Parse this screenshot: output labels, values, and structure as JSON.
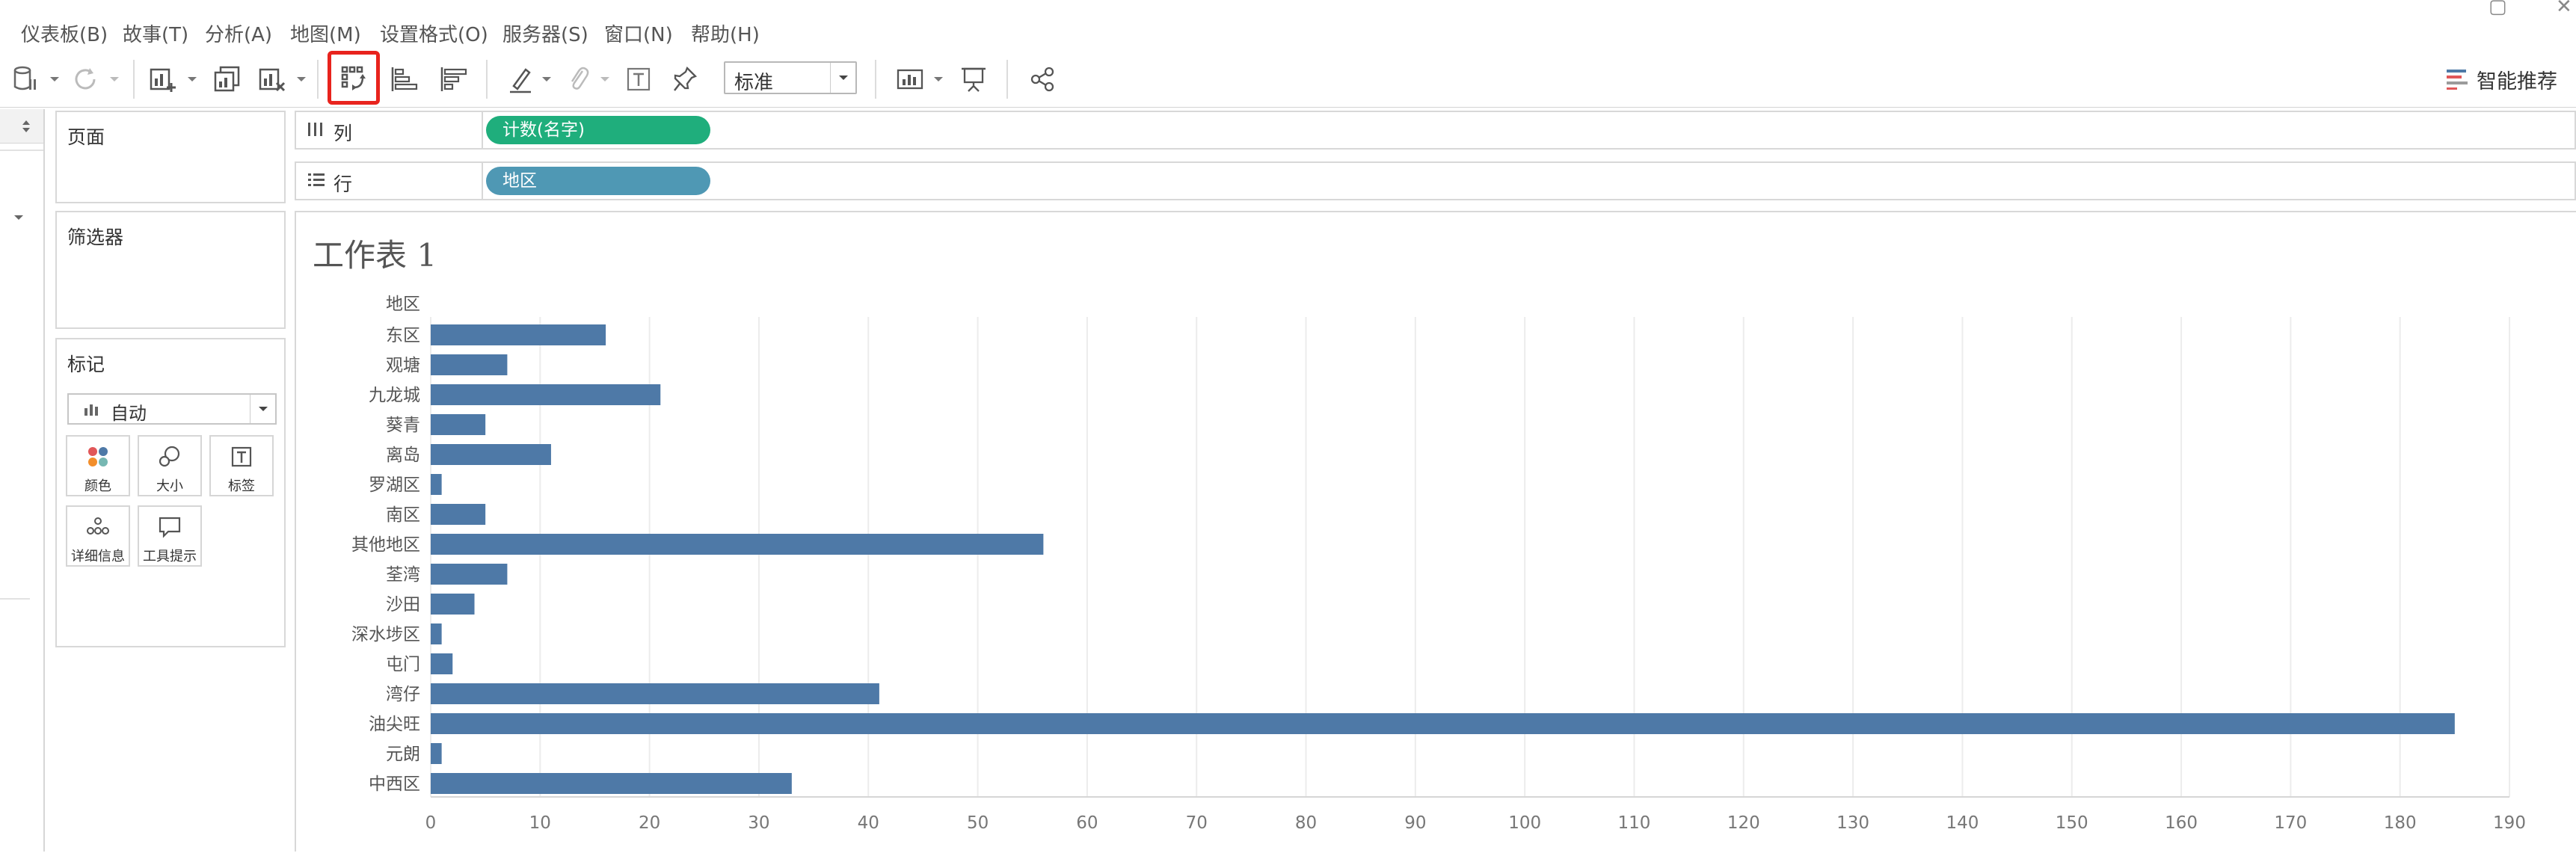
{
  "menu": [
    "仪表板(B)",
    "故事(T)",
    "分析(A)",
    "地图(M)",
    "设置格式(O)",
    "服务器(S)",
    "窗口(N)",
    "帮助(H)"
  ],
  "toolbar": {
    "mark_size_select": "标准",
    "smart_recommend": "智能推荐"
  },
  "left_panels": {
    "pages": "页面",
    "filters": "筛选器",
    "marks": "标记",
    "marks_type": "自动",
    "mark_buttons": [
      "颜色",
      "大小",
      "标签",
      "详细信息",
      "工具提示"
    ]
  },
  "shelves": {
    "columns_label": "列",
    "columns_pill": "计数(名字)",
    "rows_label": "行",
    "rows_pill": "地区"
  },
  "sheet": {
    "title": "工作表 1"
  },
  "colors": {
    "bar": "#4e79a7",
    "pill_green": "#1fae7c",
    "pill_blue": "#4f98b4",
    "highlight": "#e8231d"
  },
  "chart_data": {
    "type": "bar",
    "orientation": "horizontal",
    "row_header": "地区",
    "categories": [
      "东区",
      "观塘",
      "九龙城",
      "葵青",
      "离岛",
      "罗湖区",
      "南区",
      "其他地区",
      "荃湾",
      "沙田",
      "深水埗区",
      "屯门",
      "湾仔",
      "油尖旺",
      "元朗",
      "中西区"
    ],
    "values": [
      16,
      7,
      21,
      5,
      11,
      1,
      5,
      56,
      7,
      4,
      1,
      2,
      41,
      185,
      1,
      33
    ],
    "xlim": [
      0,
      190
    ],
    "ticks": [
      0,
      10,
      20,
      30,
      40,
      50,
      60,
      70,
      80,
      90,
      100,
      110,
      120,
      130,
      140,
      150,
      160,
      170,
      180,
      190
    ],
    "grid": true
  }
}
